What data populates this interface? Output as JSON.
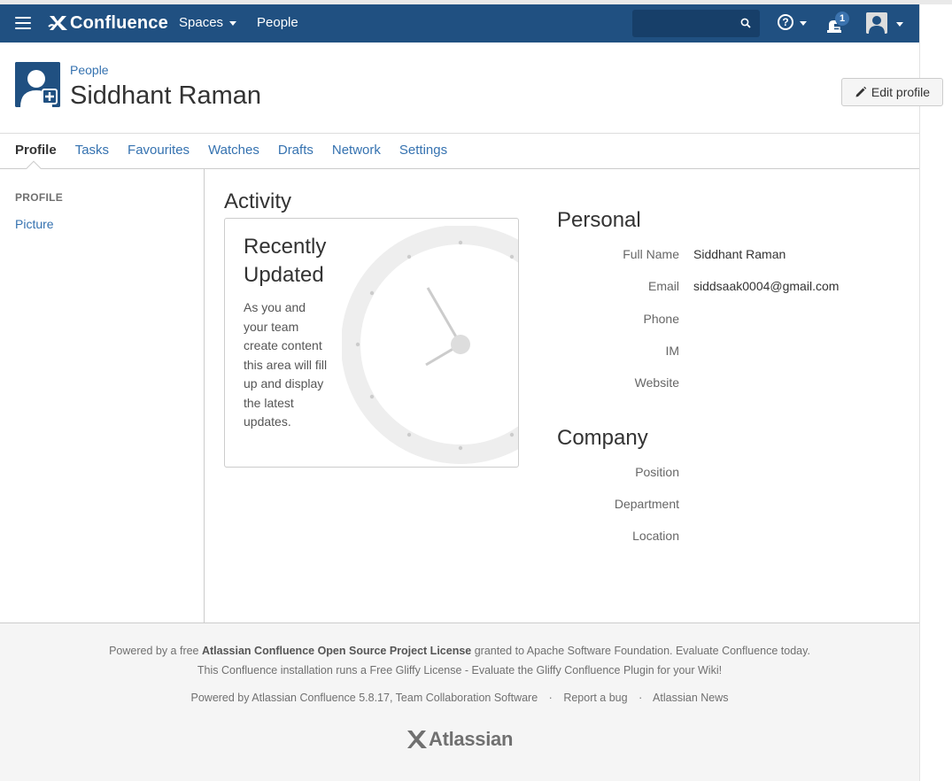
{
  "header": {
    "app_name": "Confluence",
    "nav": {
      "spaces_label": "Spaces",
      "people_label": "People"
    },
    "search_placeholder": "",
    "notification_count": "1",
    "help_glyph": "?"
  },
  "page": {
    "breadcrumb": "People",
    "title": "Siddhant Raman",
    "edit_profile_label": "Edit profile"
  },
  "tabs": [
    {
      "label": "Profile",
      "active": true
    },
    {
      "label": "Tasks"
    },
    {
      "label": "Favourites"
    },
    {
      "label": "Watches"
    },
    {
      "label": "Drafts"
    },
    {
      "label": "Network"
    },
    {
      "label": "Settings"
    }
  ],
  "sidebar": {
    "heading": "PROFILE",
    "links": [
      "Picture"
    ]
  },
  "activity": {
    "title": "Activity",
    "card_heading_line1": "Recently",
    "card_heading_line2": "Updated",
    "card_text": "As you and your team create content this area will fill up and display the latest updates."
  },
  "personal": {
    "title": "Personal",
    "fields": [
      {
        "label": "Full Name",
        "value": "Siddhant Raman"
      },
      {
        "label": "Email",
        "value": "siddsaak0004@gmail.com"
      },
      {
        "label": "Phone",
        "value": ""
      },
      {
        "label": "IM",
        "value": ""
      },
      {
        "label": "Website",
        "value": ""
      }
    ]
  },
  "company": {
    "title": "Company",
    "fields": [
      {
        "label": "Position",
        "value": ""
      },
      {
        "label": "Department",
        "value": ""
      },
      {
        "label": "Location",
        "value": ""
      }
    ]
  },
  "footer": {
    "line1_prefix": "Powered by a free ",
    "line1_bold": "Atlassian Confluence Open Source Project License",
    "line1_suffix": " granted to Apache Software Foundation. Evaluate Confluence today.",
    "line2": "This Confluence installation runs a Free Gliffy License - Evaluate the Gliffy Confluence Plugin for your Wiki!",
    "powered_by": "Powered by Atlassian Confluence 5.8.17, Team Collaboration Software",
    "sep": "·",
    "report_bug": "Report a bug",
    "atlassian_news": "Atlassian News",
    "logo_text": "Atlassian"
  },
  "colors": {
    "header_bg": "#205081",
    "link": "#3572b0",
    "search_bg": "#173f69"
  },
  "icons": {
    "menu": "hamburger-icon",
    "logo": "confluence-x-icon",
    "search": "search-icon",
    "help": "help-icon",
    "notifications": "notifications-icon",
    "user": "user-icon",
    "avatar": "default-avatar-icon",
    "edit": "pencil-icon",
    "clock": "clock-illustration"
  }
}
